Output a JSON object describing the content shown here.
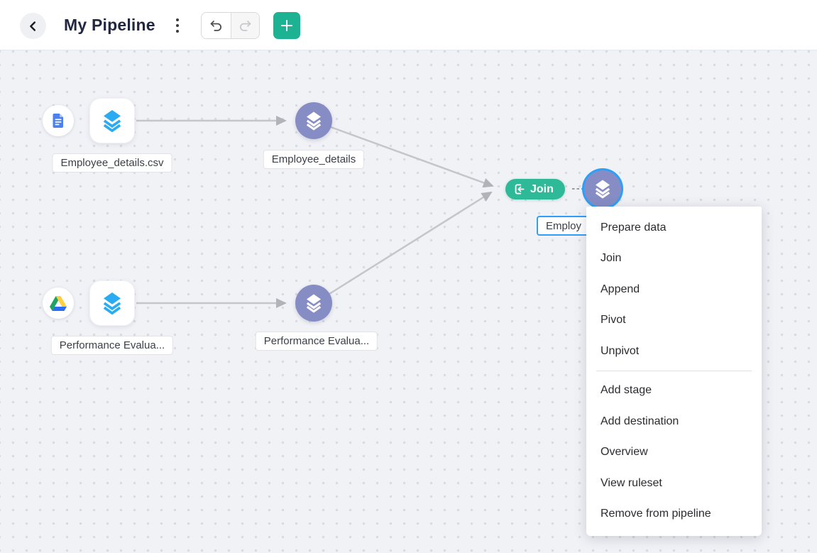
{
  "header": {
    "title": "My Pipeline"
  },
  "pipeline": {
    "source1": {
      "label": "Employee_details.csv",
      "badge_icon": "document-icon"
    },
    "stage1": {
      "label": "Employee_details"
    },
    "source2": {
      "label": "Performance Evalua...",
      "badge_icon": "google-drive-icon"
    },
    "stage2": {
      "label": "Performance Evalua..."
    },
    "join": {
      "label": "Join"
    },
    "selected_stage": {
      "label": "Employ"
    }
  },
  "context_menu": {
    "group1": [
      "Prepare data",
      "Join",
      "Append",
      "Pivot",
      "Unpivot"
    ],
    "group2": [
      "Add stage",
      "Add destination",
      "Overview",
      "View ruleset",
      "Remove from pipeline"
    ]
  },
  "colors": {
    "accent_green": "#1db392",
    "join_green": "#2eba98",
    "node_purple": "#868dc4",
    "stack_icon_blue": "#2aabf2",
    "document_blue": "#4a80f0",
    "selection_blue": "#2e9fff",
    "edge_gray": "#c5c5ca"
  }
}
